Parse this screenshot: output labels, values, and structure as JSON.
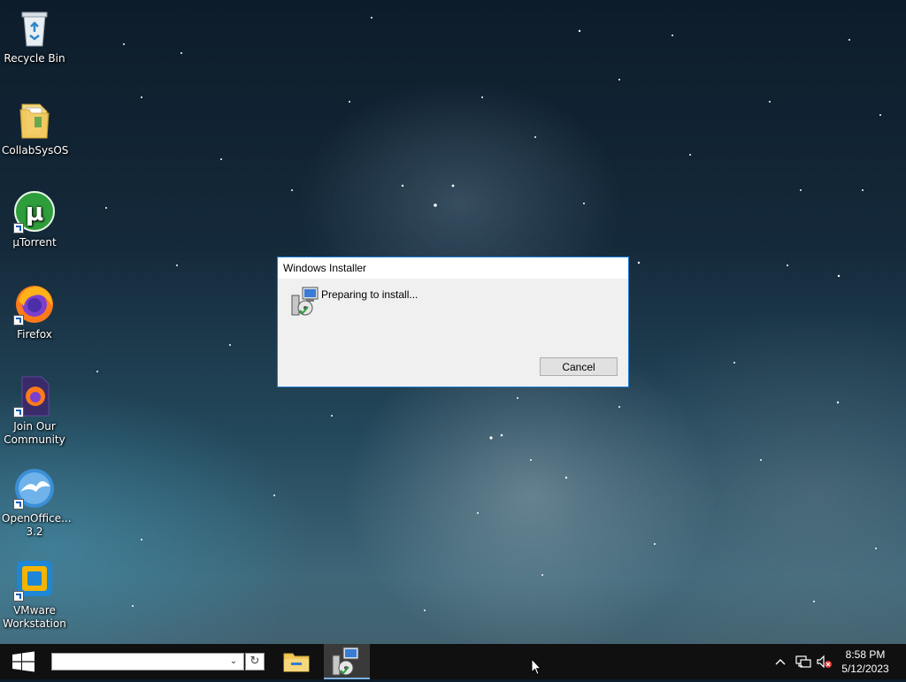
{
  "desktop": {
    "icons": [
      {
        "label": "Recycle Bin",
        "icon": "recycle-bin-icon"
      },
      {
        "label": "CollabSysOS",
        "icon": "folder-icon"
      },
      {
        "label": "µTorrent",
        "icon": "utorrent-icon"
      },
      {
        "label": "Firefox",
        "icon": "firefox-icon"
      },
      {
        "label": "Join Our Community",
        "icon": "firefox-doc-icon"
      },
      {
        "label": "OpenOffice... 3.2",
        "icon": "openoffice-icon"
      },
      {
        "label": "VMware Workstation",
        "icon": "vmware-icon"
      }
    ]
  },
  "dialog": {
    "title": "Windows Installer",
    "message": "Preparing to install...",
    "cancel_label": "Cancel",
    "icon": "installer-icon"
  },
  "taskbar": {
    "start_icon": "windows-logo-icon",
    "search": {
      "value": "",
      "placeholder": ""
    },
    "apps": [
      {
        "name": "File Explorer",
        "icon": "file-explorer-icon",
        "active": false
      },
      {
        "name": "Windows Installer",
        "icon": "installer-icon",
        "active": true
      }
    ],
    "tray": {
      "icons": [
        "chevron-up-icon",
        "network-icon",
        "volume-muted-icon"
      ],
      "time": "8:58 PM",
      "date": "5/12/2023"
    }
  },
  "colors": {
    "dialog_border": "#1c7ad4",
    "taskbar_bg": "#101010",
    "accent": "#7cb0e0"
  }
}
